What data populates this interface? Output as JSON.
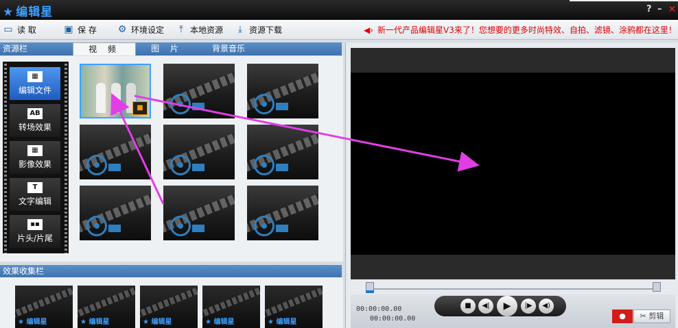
{
  "window": {
    "title": "编辑星",
    "help": "?",
    "minimize": "–",
    "close": "×"
  },
  "toolbar": {
    "read": "读 取",
    "save": "保 存",
    "env": "环境设定",
    "local": "本地资源",
    "download": "资源下载",
    "promo": "新一代产品编辑星V3来了！您想要的更多时尚特效、自拍、滤镜、涂鸦都在这里！"
  },
  "resource": {
    "title": "资源栏",
    "tabs": [
      "视 频",
      "图 片",
      "背景音乐"
    ]
  },
  "sidebar": {
    "items": [
      "编辑文件",
      "转场效果",
      "影像效果",
      "文字编辑",
      "片头/片尾"
    ],
    "icons": [
      "film",
      "AB",
      "film-edit",
      "T",
      "blocks"
    ]
  },
  "effects": {
    "title": "效果收集栏",
    "label": "编辑星"
  },
  "player": {
    "time_current": "00:00:00.00",
    "time_total": "00:00:00.00",
    "cut_label": "剪辑"
  },
  "colors": {
    "accent": "#3aa0ff",
    "promo": "#e00000",
    "arrow": "#e23ee6"
  }
}
